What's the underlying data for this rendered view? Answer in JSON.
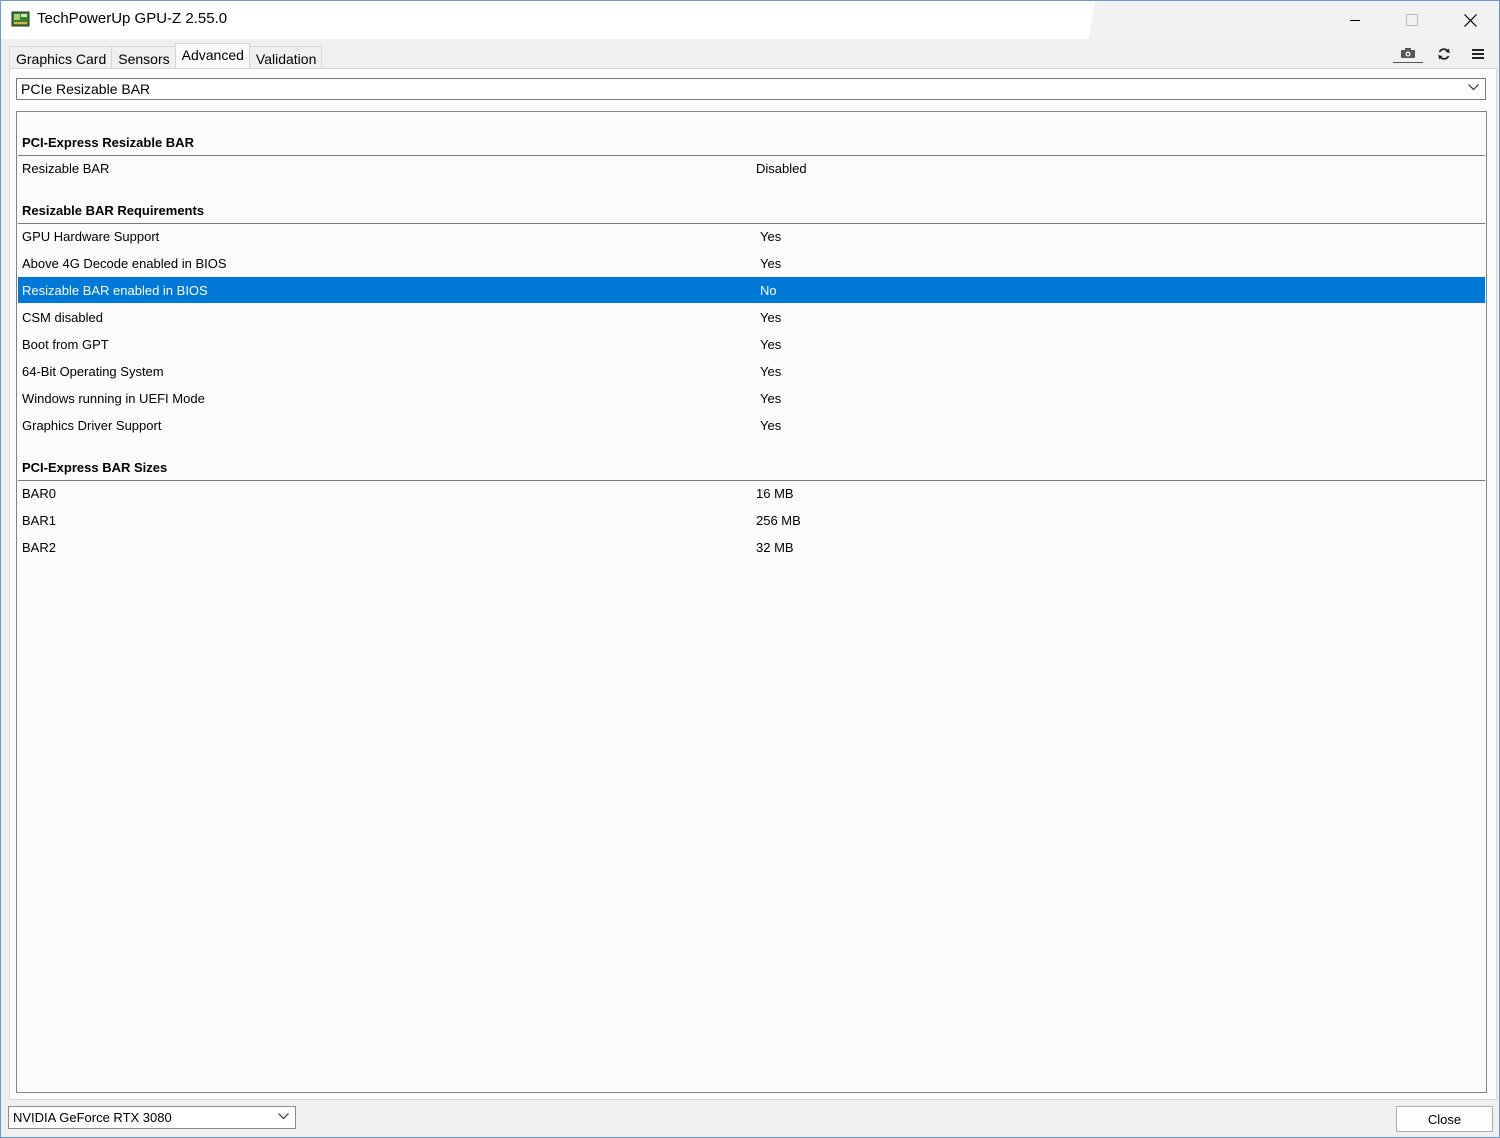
{
  "window": {
    "title": "TechPowerUp GPU-Z 2.55.0"
  },
  "tabs": [
    {
      "label": "Graphics Card"
    },
    {
      "label": "Sensors"
    },
    {
      "label": "Advanced",
      "active": true
    },
    {
      "label": "Validation"
    }
  ],
  "toolbar": {
    "icons": [
      "camera-icon",
      "refresh-icon",
      "menu-icon"
    ]
  },
  "section_select": {
    "value": "PCIe Resizable BAR"
  },
  "sections": {
    "rebar": {
      "title": "PCI-Express Resizable BAR",
      "rows": [
        {
          "label": "Resizable BAR",
          "value": "Disabled"
        }
      ]
    },
    "requirements": {
      "title": "Resizable BAR Requirements",
      "rows": [
        {
          "label": "GPU Hardware Support",
          "value": "Yes"
        },
        {
          "label": "Above 4G Decode enabled in BIOS",
          "value": "Yes"
        },
        {
          "label": "Resizable BAR enabled in BIOS",
          "value": "No",
          "selected": true
        },
        {
          "label": "CSM disabled",
          "value": "Yes"
        },
        {
          "label": "Boot from GPT",
          "value": "Yes"
        },
        {
          "label": "64-Bit Operating System",
          "value": "Yes"
        },
        {
          "label": "Windows running in UEFI Mode",
          "value": "Yes"
        },
        {
          "label": "Graphics Driver Support",
          "value": "Yes"
        }
      ]
    },
    "bar_sizes": {
      "title": "PCI-Express BAR Sizes",
      "rows": [
        {
          "label": "BAR0",
          "value": "16 MB"
        },
        {
          "label": "BAR1",
          "value": "256 MB"
        },
        {
          "label": "BAR2",
          "value": "32 MB"
        }
      ]
    }
  },
  "footer": {
    "gpu_select": "NVIDIA GeForce RTX 3080",
    "close_label": "Close"
  },
  "colors": {
    "selection": "#0078d7",
    "window_border": "#6b9bd1"
  }
}
